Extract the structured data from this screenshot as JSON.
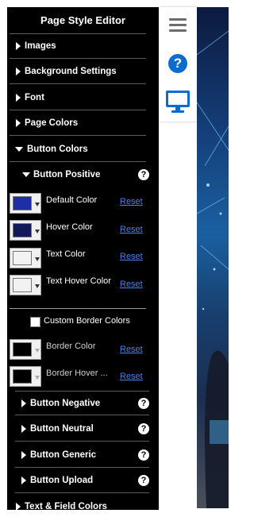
{
  "editor": {
    "title": "Page Style Editor",
    "sections": [
      {
        "label": "Images",
        "expanded": false
      },
      {
        "label": "Background Settings",
        "expanded": false
      },
      {
        "label": "Font",
        "expanded": false
      },
      {
        "label": "Page Colors",
        "expanded": false
      },
      {
        "label": "Button Colors",
        "expanded": true
      }
    ],
    "button_positive": {
      "label": "Button Positive",
      "help": "?",
      "colors": [
        {
          "label": "Default Color",
          "value": "#1e2fa6",
          "reset": "Reset"
        },
        {
          "label": "Hover Color",
          "value": "#121a5c",
          "reset": "Reset"
        },
        {
          "label": "Text Color",
          "value": "#f2f2f2",
          "reset": "Reset"
        },
        {
          "label": "Text Hover Color",
          "value": "#f2f2f2",
          "reset": "Reset"
        }
      ],
      "custom_border_label": "Custom Border Colors",
      "custom_border_checked": false,
      "border_colors": [
        {
          "label": "Border Color",
          "value": "#000000",
          "reset": "Reset"
        },
        {
          "label": "Border Hover ...",
          "value": "#000000",
          "reset": "Reset"
        }
      ]
    },
    "subsections": [
      {
        "label": "Button Negative",
        "help": "?"
      },
      {
        "label": "Button Neutral",
        "help": "?"
      },
      {
        "label": "Button Generic",
        "help": "?"
      },
      {
        "label": "Button Upload",
        "help": "?"
      }
    ],
    "next_section": {
      "label": "Text & Field Colors"
    }
  },
  "toolbar": {
    "menu_icon": "hamburger-menu-icon",
    "help_icon": "question-icon",
    "help_glyph": "?",
    "device_icon": "desktop-monitor-icon",
    "accent_color": "#0a6ccf"
  }
}
